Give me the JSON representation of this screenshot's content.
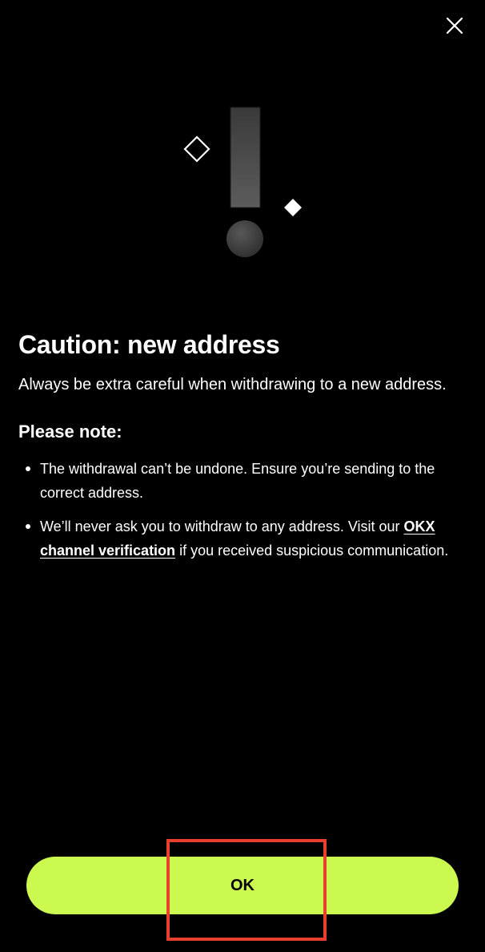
{
  "dialog": {
    "close_icon": "close-icon",
    "illustration_icon": "exclamation-warning-icon",
    "title": "Caution: new address",
    "intro": "Always be extra careful when withdrawing to a new address.",
    "note_heading": "Please note:",
    "bullets": [
      {
        "text": "The withdrawal can’t be undone. Ensure you’re sending to the correct address."
      },
      {
        "text_before": "We’ll never ask you to withdraw to any address. Visit our ",
        "link_label": "OKX channel verification",
        "text_after": " if you received suspicious communication."
      }
    ],
    "ok_label": "OK"
  },
  "colors": {
    "background": "#000000",
    "text": "#ffffff",
    "accent": "#ccf94f",
    "highlight": "#e8402c"
  }
}
